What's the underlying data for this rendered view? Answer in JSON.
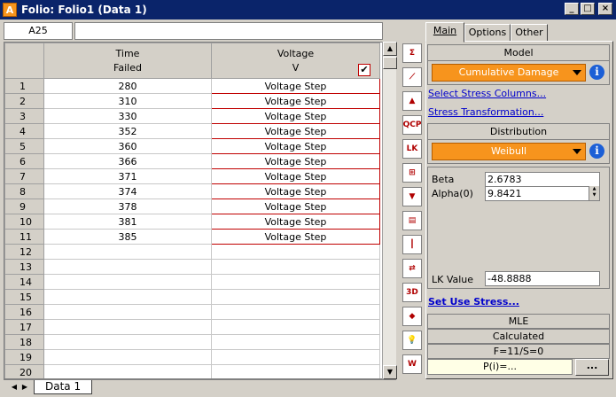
{
  "window": {
    "title": "Folio: Folio1 (Data 1)",
    "app_icon": "A"
  },
  "refbar": {
    "cell_ref": "A25",
    "formula": ""
  },
  "grid": {
    "col_time": {
      "line1": "Time",
      "line2": "Failed"
    },
    "col_voltage": {
      "line1": "Voltage",
      "line2": "V",
      "checked_mark": "✔"
    },
    "rows": [
      {
        "n": "1",
        "time": "280",
        "voltage": "Voltage Step"
      },
      {
        "n": "2",
        "time": "310",
        "voltage": "Voltage Step"
      },
      {
        "n": "3",
        "time": "330",
        "voltage": "Voltage Step"
      },
      {
        "n": "4",
        "time": "352",
        "voltage": "Voltage Step"
      },
      {
        "n": "5",
        "time": "360",
        "voltage": "Voltage Step"
      },
      {
        "n": "6",
        "time": "366",
        "voltage": "Voltage Step"
      },
      {
        "n": "7",
        "time": "371",
        "voltage": "Voltage Step"
      },
      {
        "n": "8",
        "time": "374",
        "voltage": "Voltage Step"
      },
      {
        "n": "9",
        "time": "378",
        "voltage": "Voltage Step"
      },
      {
        "n": "10",
        "time": "381",
        "voltage": "Voltage Step"
      },
      {
        "n": "11",
        "time": "385",
        "voltage": "Voltage Step"
      },
      {
        "n": "12",
        "time": "",
        "voltage": ""
      },
      {
        "n": "13",
        "time": "",
        "voltage": ""
      },
      {
        "n": "14",
        "time": "",
        "voltage": ""
      },
      {
        "n": "15",
        "time": "",
        "voltage": ""
      },
      {
        "n": "16",
        "time": "",
        "voltage": ""
      },
      {
        "n": "17",
        "time": "",
        "voltage": ""
      },
      {
        "n": "18",
        "time": "",
        "voltage": ""
      },
      {
        "n": "19",
        "time": "",
        "voltage": ""
      },
      {
        "n": "20",
        "time": "",
        "voltage": ""
      }
    ]
  },
  "sheet_tab": "Data 1",
  "toolbar": {
    "icons": [
      {
        "name": "calculate-icon",
        "glyph": "Σ"
      },
      {
        "name": "plot-icon",
        "glyph": "⟋"
      },
      {
        "name": "mountain-plot-icon",
        "glyph": "▲"
      },
      {
        "name": "qcp-icon",
        "glyph": "QCP"
      },
      {
        "name": "likelihood-icon",
        "glyph": "LK"
      },
      {
        "name": "plot-type-icon",
        "glyph": "⊞"
      },
      {
        "name": "filter-icon",
        "glyph": "▼"
      },
      {
        "name": "batch-icon",
        "glyph": "▤"
      },
      {
        "name": "stress-icon",
        "glyph": "┃"
      },
      {
        "name": "transfer-icon",
        "glyph": "⇄"
      },
      {
        "name": "3d-plot-icon",
        "glyph": "3D"
      },
      {
        "name": "tag-icon",
        "glyph": "◆"
      },
      {
        "name": "idea-icon",
        "glyph": "💡"
      },
      {
        "name": "word-icon",
        "glyph": "W"
      }
    ]
  },
  "panel": {
    "tabs": [
      {
        "label": "Main",
        "active": true
      },
      {
        "label": "Options",
        "active": false
      },
      {
        "label": "Other",
        "active": false
      }
    ],
    "model": {
      "heading": "Model",
      "value": "Cumulative Damage"
    },
    "link_select_stress": "Select Stress Columns...",
    "link_stress_transformation": "Stress Transformation...",
    "distribution": {
      "heading": "Distribution",
      "value": "Weibull"
    },
    "params": {
      "beta_label": "Beta",
      "beta_value": "2.6783",
      "alpha_label": "Alpha(0)",
      "alpha_value": "9.8421"
    },
    "lk": {
      "label": "LK Value",
      "value": "-48.8888"
    },
    "link_set_use_stress": "Set Use Stress...",
    "status": {
      "method": "MLE",
      "calc": "Calculated",
      "counts": "F=11/S=0",
      "p_value": "P(i)=...",
      "more_button": "..."
    }
  },
  "colors": {
    "accent_orange": "#f7941d",
    "title_bar": "#0a246a",
    "link_blue": "#0000cc",
    "info_blue": "#1c5fd6",
    "highlight_red": "#c00000"
  }
}
